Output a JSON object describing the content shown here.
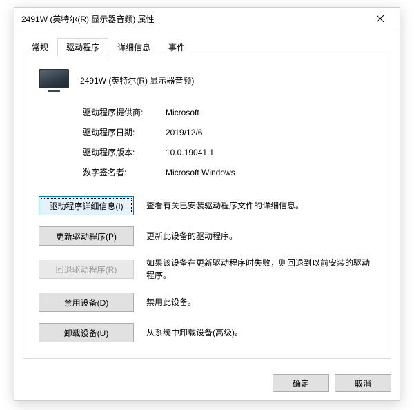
{
  "window": {
    "title": "2491W (英特尔(R) 显示器音频) 属性"
  },
  "tabs": {
    "general": "常规",
    "driver": "驱动程序",
    "details": "详细信息",
    "events": "事件"
  },
  "device": {
    "name": "2491W (英特尔(R) 显示器音频)"
  },
  "kv": {
    "provider_label": "驱动程序提供商:",
    "provider_value": "Microsoft",
    "date_label": "驱动程序日期:",
    "date_value": "2019/12/6",
    "version_label": "驱动程序版本:",
    "version_value": "10.0.19041.1",
    "signer_label": "数字签名者:",
    "signer_value": "Microsoft Windows"
  },
  "actions": {
    "details_btn": "驱动程序详细信息(I)",
    "details_desc": "查看有关已安装驱动程序文件的详细信息。",
    "update_btn": "更新驱动程序(P)",
    "update_desc": "更新此设备的驱动程序。",
    "rollback_btn": "回退驱动程序(R)",
    "rollback_desc": "如果该设备在更新驱动程序时失败，则回退到以前安装的驱动程序。",
    "disable_btn": "禁用设备(D)",
    "disable_desc": "禁用此设备。",
    "uninstall_btn": "卸载设备(U)",
    "uninstall_desc": "从系统中卸载设备(高级)。"
  },
  "footer": {
    "ok": "确定",
    "cancel": "取消"
  }
}
